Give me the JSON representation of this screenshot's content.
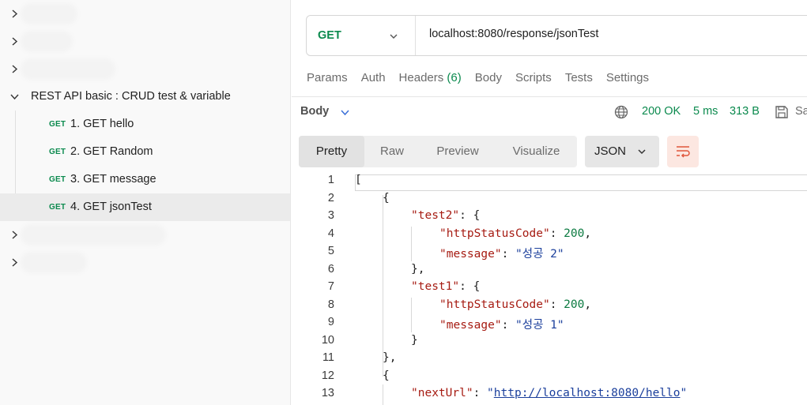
{
  "sidebar": {
    "folder": "REST API basic : CRUD test & variable",
    "requests": [
      {
        "method": "GET",
        "name": "1. GET hello"
      },
      {
        "method": "GET",
        "name": "2. GET Random"
      },
      {
        "method": "GET",
        "name": "3. GET message"
      },
      {
        "method": "GET",
        "name": "4. GET jsonTest"
      }
    ]
  },
  "request": {
    "method": "GET",
    "url": "localhost:8080/response/jsonTest",
    "tabs": [
      "Params",
      "Auth",
      "Headers",
      "Body",
      "Scripts",
      "Tests",
      "Settings"
    ],
    "headers_count": "(6)"
  },
  "response": {
    "title": "Body",
    "status": "200 OK",
    "time": "5 ms",
    "size": "313 B",
    "save_label": "Sa",
    "views": [
      "Pretty",
      "Raw",
      "Preview",
      "Visualize"
    ],
    "format": "JSON"
  },
  "code": {
    "line_numbers": [
      "1",
      "2",
      "3",
      "4",
      "5",
      "6",
      "7",
      "8",
      "9",
      "10",
      "11",
      "12",
      "13"
    ],
    "l1": "[",
    "l2": "{",
    "l3_key": "\"test2\"",
    "l3_rest": ": {",
    "l4_key": "\"httpStatusCode\"",
    "l4_sep": ": ",
    "l4_val": "200",
    "l4_end": ",",
    "l5_key": "\"message\"",
    "l5_sep": ": ",
    "l5_val": "\"성공 2\"",
    "l6": "},",
    "l7_key": "\"test1\"",
    "l7_rest": ": {",
    "l8_key": "\"httpStatusCode\"",
    "l8_sep": ": ",
    "l8_val": "200",
    "l8_end": ",",
    "l9_key": "\"message\"",
    "l9_sep": ": ",
    "l9_val": "\"성공 1\"",
    "l10": "}",
    "l11": "},",
    "l12": "{",
    "l13_key": "\"nextUrl\"",
    "l13_sep": ": ",
    "l13_q1": "\"",
    "l13_val": "http://localhost:8080/hello",
    "l13_q2": "\""
  }
}
